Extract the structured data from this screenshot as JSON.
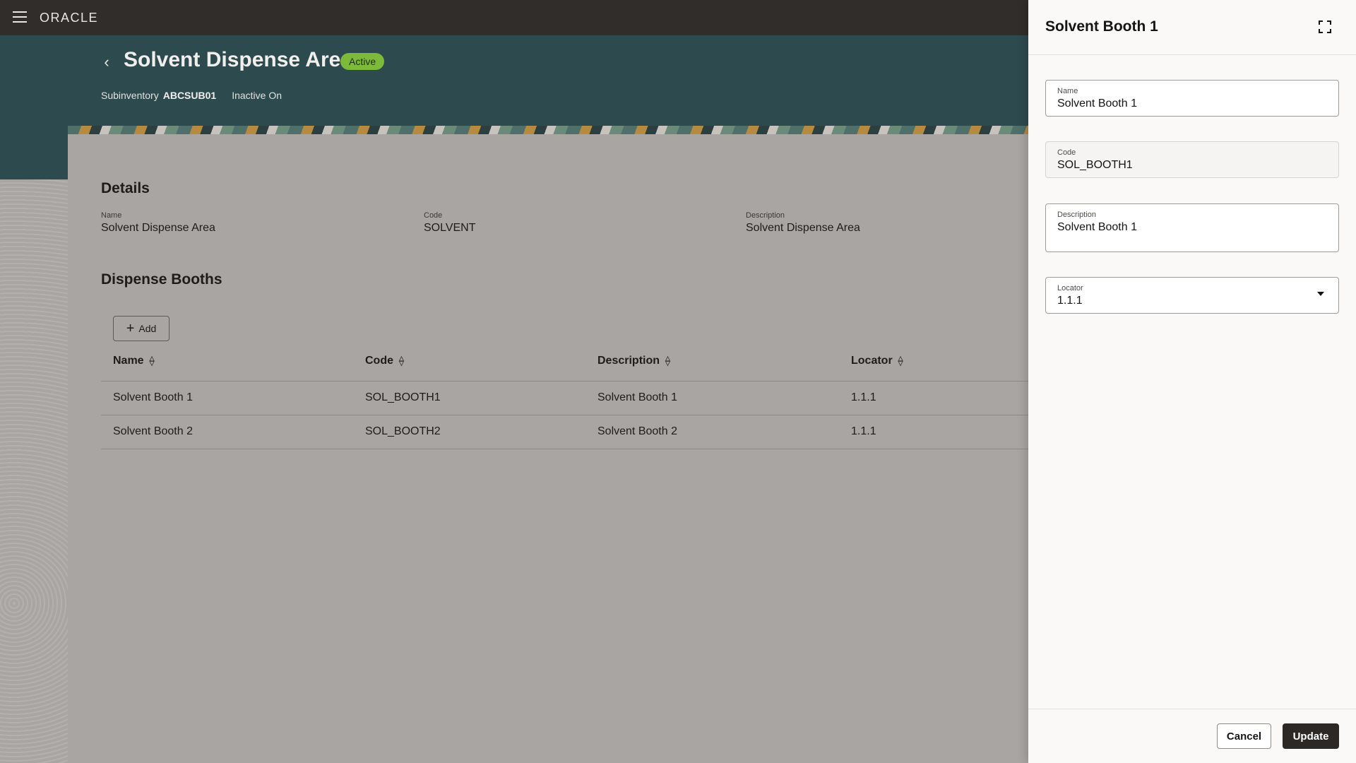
{
  "topbar": {
    "brand": "ORACLE"
  },
  "header": {
    "title": "Solvent Dispense Area",
    "status": "Active",
    "subinventory_label": "Subinventory",
    "subinventory_value": "ABCSUB01",
    "inactive_label": "Inactive On"
  },
  "details": {
    "title": "Details",
    "fields": [
      {
        "label": "Name",
        "value": "Solvent Dispense Area"
      },
      {
        "label": "Code",
        "value": "SOLVENT"
      },
      {
        "label": "Description",
        "value": "Solvent Dispense Area"
      }
    ]
  },
  "booths": {
    "title": "Dispense Booths",
    "add_label": "Add",
    "columns": [
      "Name",
      "Code",
      "Description",
      "Locator"
    ],
    "rows": [
      [
        "Solvent Booth 1",
        "SOL_BOOTH1",
        "Solvent Booth 1",
        "1.1.1"
      ],
      [
        "Solvent Booth 2",
        "SOL_BOOTH2",
        "Solvent Booth 2",
        "1.1.1"
      ]
    ]
  },
  "drawer": {
    "title": "Solvent Booth 1",
    "fields": {
      "name": {
        "label": "Name",
        "value": "Solvent Booth 1"
      },
      "code": {
        "label": "Code",
        "value": "SOL_BOOTH1"
      },
      "description": {
        "label": "Description",
        "value": "Solvent Booth 1"
      },
      "locator": {
        "label": "Locator",
        "value": "1.1.1"
      }
    },
    "cancel_label": "Cancel",
    "update_label": "Update"
  },
  "icons": {
    "menu": "hamburger-icon",
    "back": "chevron-left-icon",
    "add": "plus-icon",
    "sort": "sort-icon",
    "expand": "expand-icon",
    "dropdown": "caret-down-icon"
  },
  "colors": {
    "topbar": "#312d2a",
    "header_band": "#2d4a4f",
    "status_badge": "#7dba3a",
    "overlay_background": "#a9a5a2",
    "primary_button": "#2b2826"
  }
}
